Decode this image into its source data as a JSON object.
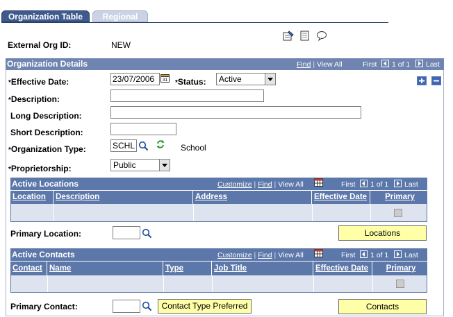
{
  "tabs": [
    {
      "label": "Organization Table"
    },
    {
      "label": "Regional"
    }
  ],
  "header": {
    "ext_org_label": "External Org ID:",
    "ext_org_value": "NEW"
  },
  "details": {
    "title": "Organization Details",
    "nav": {
      "find": "Find",
      "view_all": "View All",
      "first": "First",
      "count": "1 of 1",
      "last": "Last",
      "sep": "|"
    },
    "effective_date_label": "Effective Date:",
    "effective_date_value": "23/07/2006",
    "status_label": "Status:",
    "status_value": "Active",
    "description_label": "Description:",
    "long_description_label": "Long Description:",
    "short_description_label": "Short Description:",
    "org_type_label": "Organization Type:",
    "org_type_value": "SCHL",
    "org_type_desc": "School",
    "proprietorship_label": "Proprietorship:",
    "proprietorship_value": "Public",
    "required_mark": "*"
  },
  "locations": {
    "title": "Active Locations",
    "nav": {
      "customize": "Customize",
      "find": "Find",
      "view_all": "View All",
      "first": "First",
      "count": "1 of 1",
      "last": "Last",
      "sep": "|"
    },
    "columns": [
      "Location",
      "Description",
      "Address",
      "Effective Date",
      "Primary"
    ],
    "primary_location_label": "Primary Location:",
    "button": "Locations"
  },
  "contacts": {
    "title": "Active Contacts",
    "nav": {
      "customize": "Customize",
      "find": "Find",
      "view_all": "View All",
      "first": "First",
      "count": "1 of 1",
      "last": "Last",
      "sep": "|"
    },
    "columns": [
      "Contact",
      "Name",
      "Type",
      "Job Title",
      "Effective Date",
      "Primary"
    ],
    "primary_contact_label": "Primary Contact:",
    "type_button": "Contact Type Preferred",
    "button": "Contacts"
  }
}
